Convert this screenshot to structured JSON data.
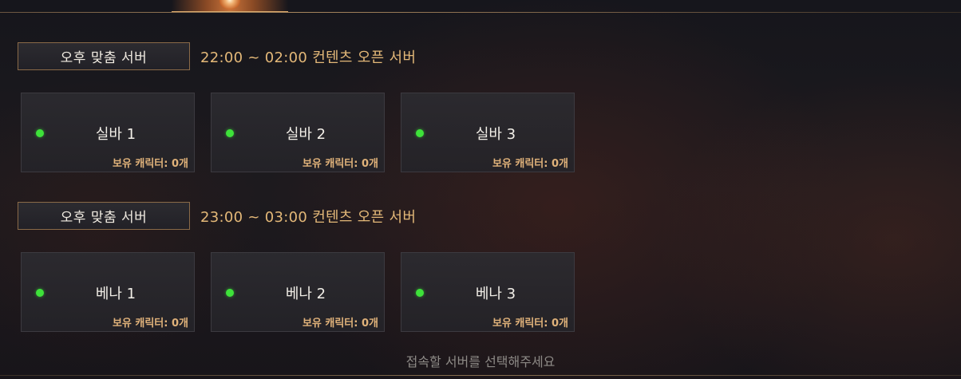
{
  "groups": [
    {
      "tag": "오후 맞춤 서버",
      "time": "22:00 ~ 02:00 컨텐츠 오픈 서버",
      "servers": [
        {
          "name": "실바 1",
          "chars": "보유 캐릭터: 0개",
          "status": "online"
        },
        {
          "name": "실바 2",
          "chars": "보유 캐릭터: 0개",
          "status": "online"
        },
        {
          "name": "실바 3",
          "chars": "보유 캐릭터: 0개",
          "status": "online"
        }
      ]
    },
    {
      "tag": "오후 맞춤 서버",
      "time": "23:00 ~ 03:00 컨텐츠 오픈 서버",
      "servers": [
        {
          "name": "베나 1",
          "chars": "보유 캐릭터: 0개",
          "status": "online"
        },
        {
          "name": "베나 2",
          "chars": "보유 캐릭터: 0개",
          "status": "online"
        },
        {
          "name": "베나 3",
          "chars": "보유 캐릭터: 0개",
          "status": "online"
        }
      ]
    }
  ],
  "footer": {
    "message": "접속할 서버를 선택해주세요"
  },
  "colors": {
    "accent": "#e3b878",
    "status_online": "#3ee23a",
    "footer_text": "#8d8a86"
  }
}
